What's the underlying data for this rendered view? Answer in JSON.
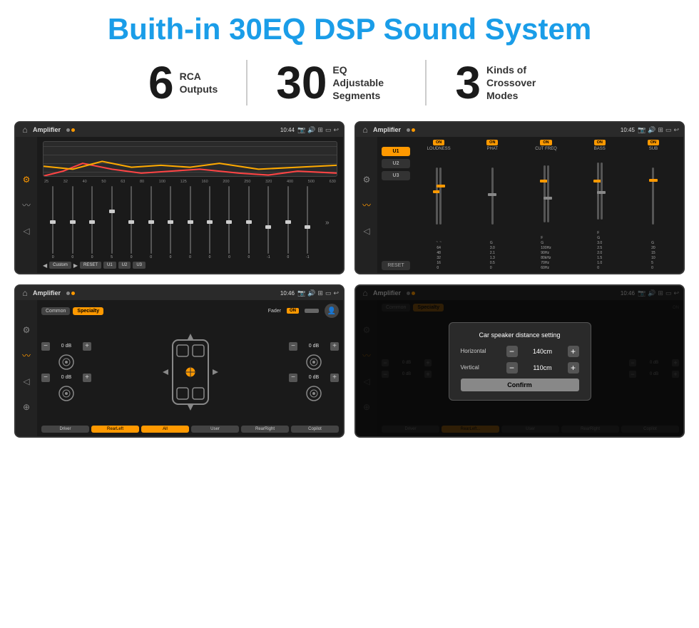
{
  "header": {
    "title": "Buith-in 30EQ DSP Sound System"
  },
  "stats": [
    {
      "number": "6",
      "label": "RCA\nOutputs"
    },
    {
      "number": "30",
      "label": "EQ Adjustable\nSegments"
    },
    {
      "number": "3",
      "label": "Kinds of\nCrossover Modes"
    }
  ],
  "screens": {
    "eq": {
      "topbar": {
        "title": "Amplifier",
        "time": "10:44"
      },
      "freq_labels": [
        "25",
        "32",
        "40",
        "50",
        "63",
        "80",
        "100",
        "125",
        "160",
        "200",
        "250",
        "320",
        "400",
        "500",
        "630"
      ],
      "eq_values": [
        "0",
        "0",
        "0",
        "5",
        "0",
        "0",
        "0",
        "0",
        "0",
        "0",
        "0",
        "-1",
        "0",
        "-1"
      ],
      "presets": [
        "Custom",
        "RESET",
        "U1",
        "U2",
        "U3"
      ]
    },
    "crossover": {
      "topbar": {
        "title": "Amplifier",
        "time": "10:45"
      },
      "presets": [
        "U1",
        "U2",
        "U3"
      ],
      "channels": [
        {
          "label": "LOUDNESS",
          "toggle": "ON"
        },
        {
          "label": "PHAT",
          "toggle": "ON"
        },
        {
          "label": "CUT FREQ",
          "toggle": "ON"
        },
        {
          "label": "BASS",
          "toggle": "ON"
        },
        {
          "label": "SUB",
          "toggle": "ON"
        }
      ]
    },
    "fader": {
      "topbar": {
        "title": "Amplifier",
        "time": "10:46"
      },
      "tabs": [
        "Common",
        "Specialty"
      ],
      "fader_label": "Fader",
      "fader_on": "ON",
      "positions_left": [
        {
          "label": "— 0 dB +",
          "value": "0 dB"
        },
        {
          "label": "— 0 dB +",
          "value": "0 dB"
        }
      ],
      "positions_right": [
        {
          "label": "— 0 dB +",
          "value": "0 dB"
        },
        {
          "label": "— 0 dB +",
          "value": "0 dB"
        }
      ],
      "bottom_buttons": [
        "Driver",
        "RearLeft",
        "All",
        "User",
        "RearRight",
        "Copilot"
      ]
    },
    "dialog": {
      "topbar": {
        "title": "Amplifier",
        "time": "10:46"
      },
      "dialog_title": "Car speaker distance setting",
      "horizontal_label": "Horizontal",
      "horizontal_value": "140cm",
      "vertical_label": "Vertical",
      "vertical_value": "110cm",
      "confirm_label": "Confirm",
      "db_right_top": "0 dB",
      "db_right_bottom": "0 dB"
    }
  }
}
